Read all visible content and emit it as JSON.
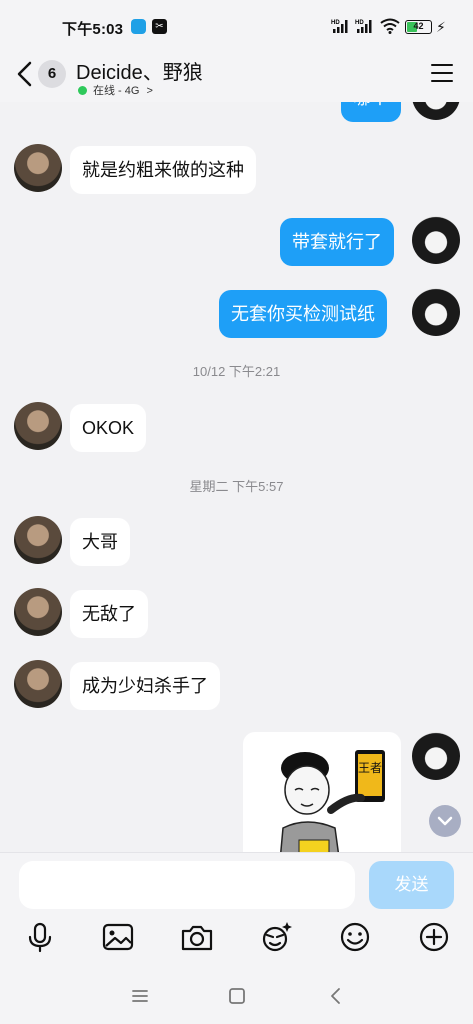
{
  "status_bar": {
    "time": "下午5:03",
    "battery": "42",
    "battery_level": 0.42,
    "signal_label": "HD"
  },
  "header": {
    "unread_count": "6",
    "title": "Deicide、野狼",
    "status": "在线 - 4G",
    "status_chevron": ">"
  },
  "messages": {
    "partial_top": "哪个",
    "m1": "就是约粗来做的这种",
    "m2": "带套就行了",
    "m3": "无套你买检测试纸",
    "ts1": "10/12 下午2:21",
    "m4": "OKOK",
    "ts2": "星期二 下午5:57",
    "m5": "大哥",
    "m6": "无敌了",
    "m7": "成为少妇杀手了",
    "sticker_text": "王者"
  },
  "composer": {
    "send_label": "发送"
  },
  "colors": {
    "sent_bubble": "#1e9ff7",
    "received_bubble": "#ffffff",
    "send_button": "#a9d8fb",
    "online_dot": "#2ec95b"
  }
}
